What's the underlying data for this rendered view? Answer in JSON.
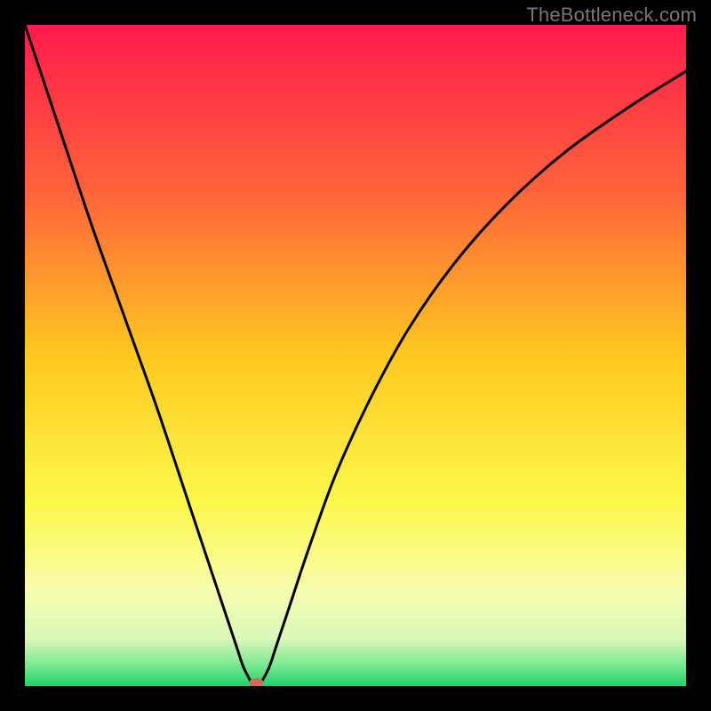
{
  "watermark": "TheBottleneck.com",
  "chart_data": {
    "type": "line",
    "title": "",
    "xlabel": "",
    "ylabel": "",
    "xlim": [
      0,
      100
    ],
    "ylim": [
      0,
      100
    ],
    "gradient_stops": [
      {
        "offset": 0,
        "color": "#ff1a4d"
      },
      {
        "offset": 25,
        "color": "#ff623a"
      },
      {
        "offset": 50,
        "color": "#ffc820"
      },
      {
        "offset": 72,
        "color": "#fcf84a"
      },
      {
        "offset": 86,
        "color": "#f6fcb0"
      },
      {
        "offset": 93,
        "color": "#d8f7b8"
      },
      {
        "offset": 97,
        "color": "#74e88e"
      },
      {
        "offset": 100,
        "color": "#1fd36b"
      }
    ],
    "curve": {
      "x": [
        0,
        2,
        5,
        10,
        15,
        20,
        25,
        28,
        30,
        32,
        33,
        34,
        34.5,
        35,
        35.5,
        36,
        37,
        38,
        40,
        43,
        47,
        52,
        58,
        65,
        73,
        82,
        92,
        100
      ],
      "y": [
        100,
        94,
        85,
        70,
        56,
        42,
        27,
        18,
        12,
        6,
        3,
        1,
        0,
        0,
        0.3,
        1,
        3,
        6,
        12,
        21,
        32,
        43,
        54,
        64,
        73,
        81,
        88,
        93
      ]
    },
    "marker": {
      "x": 35,
      "y": 0,
      "color": "#d46a5a"
    }
  }
}
